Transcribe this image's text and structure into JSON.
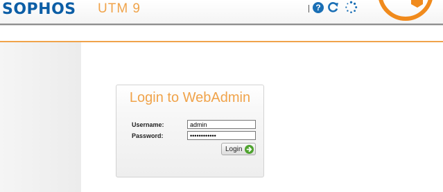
{
  "header": {
    "brand": "SOPHOS",
    "product": "UTM 9",
    "icons": [
      "help-icon",
      "refresh-icon",
      "loading-icon",
      "logo-mark"
    ],
    "help_glyph": "?"
  },
  "colors": {
    "brand_blue": "#0c5ea6",
    "accent_orange": "#f0a34a",
    "button_green": "#4fa32f"
  },
  "login": {
    "title": "Login to WebAdmin",
    "username_label": "Username:",
    "username_value": "admin",
    "password_label": "Password:",
    "password_value": "adminpass123",
    "button_label": "Login",
    "button_icon": "arrow-right-icon"
  }
}
